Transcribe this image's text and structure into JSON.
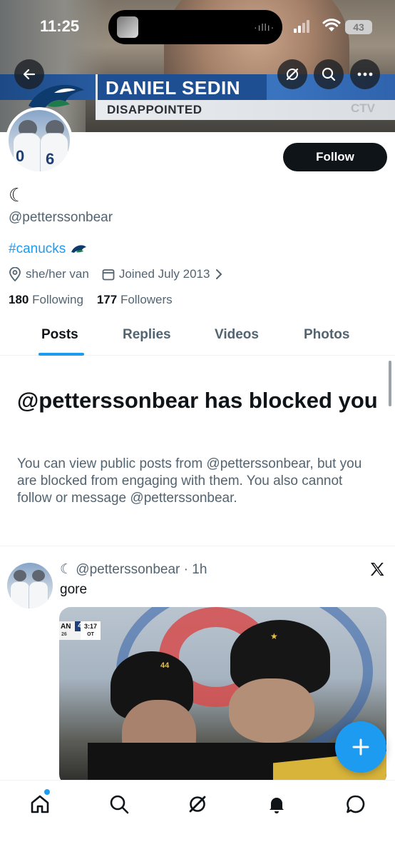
{
  "status_bar": {
    "time": "11:25",
    "battery": "43"
  },
  "banner": {
    "lower_third_name": "DANIEL SEDIN",
    "lower_third_subtitle": "DISAPPOINTED",
    "broadcaster_logo": "CTV"
  },
  "header_actions": {
    "back_icon": "arrow-left-icon",
    "grok_icon": "grok-icon",
    "search_icon": "search-icon",
    "more_icon": "more-icon"
  },
  "profile": {
    "display_name": "☾",
    "handle": "@petterssonbear",
    "bio": "#canucks",
    "location": "she/her van",
    "joined": "Joined July 2013",
    "following_count": "180",
    "following_label": "Following",
    "followers_count": "177",
    "followers_label": "Followers",
    "follow_label": "Follow"
  },
  "tabs": [
    "Posts",
    "Replies",
    "Videos",
    "Photos"
  ],
  "blocked": {
    "title": "@petterssonbear has blocked you",
    "body": "You can view public posts from @petterssonbear, but you are blocked from engaging with them. You also cannot follow or message @petterssonbear."
  },
  "post": {
    "author": "☾ @petterssonbear",
    "separator": "·",
    "time": "1h",
    "text": "gore",
    "media_scorebug": {
      "team": "AN",
      "score": "4",
      "sub": "26",
      "clock": "3:17",
      "period": "OT"
    }
  },
  "colors": {
    "accent": "#1d9bf0",
    "text": "#0f1419",
    "secondary": "#536471"
  },
  "bottom_nav": [
    "home-icon",
    "search-icon",
    "grok-icon",
    "notifications-icon",
    "messages-icon"
  ]
}
